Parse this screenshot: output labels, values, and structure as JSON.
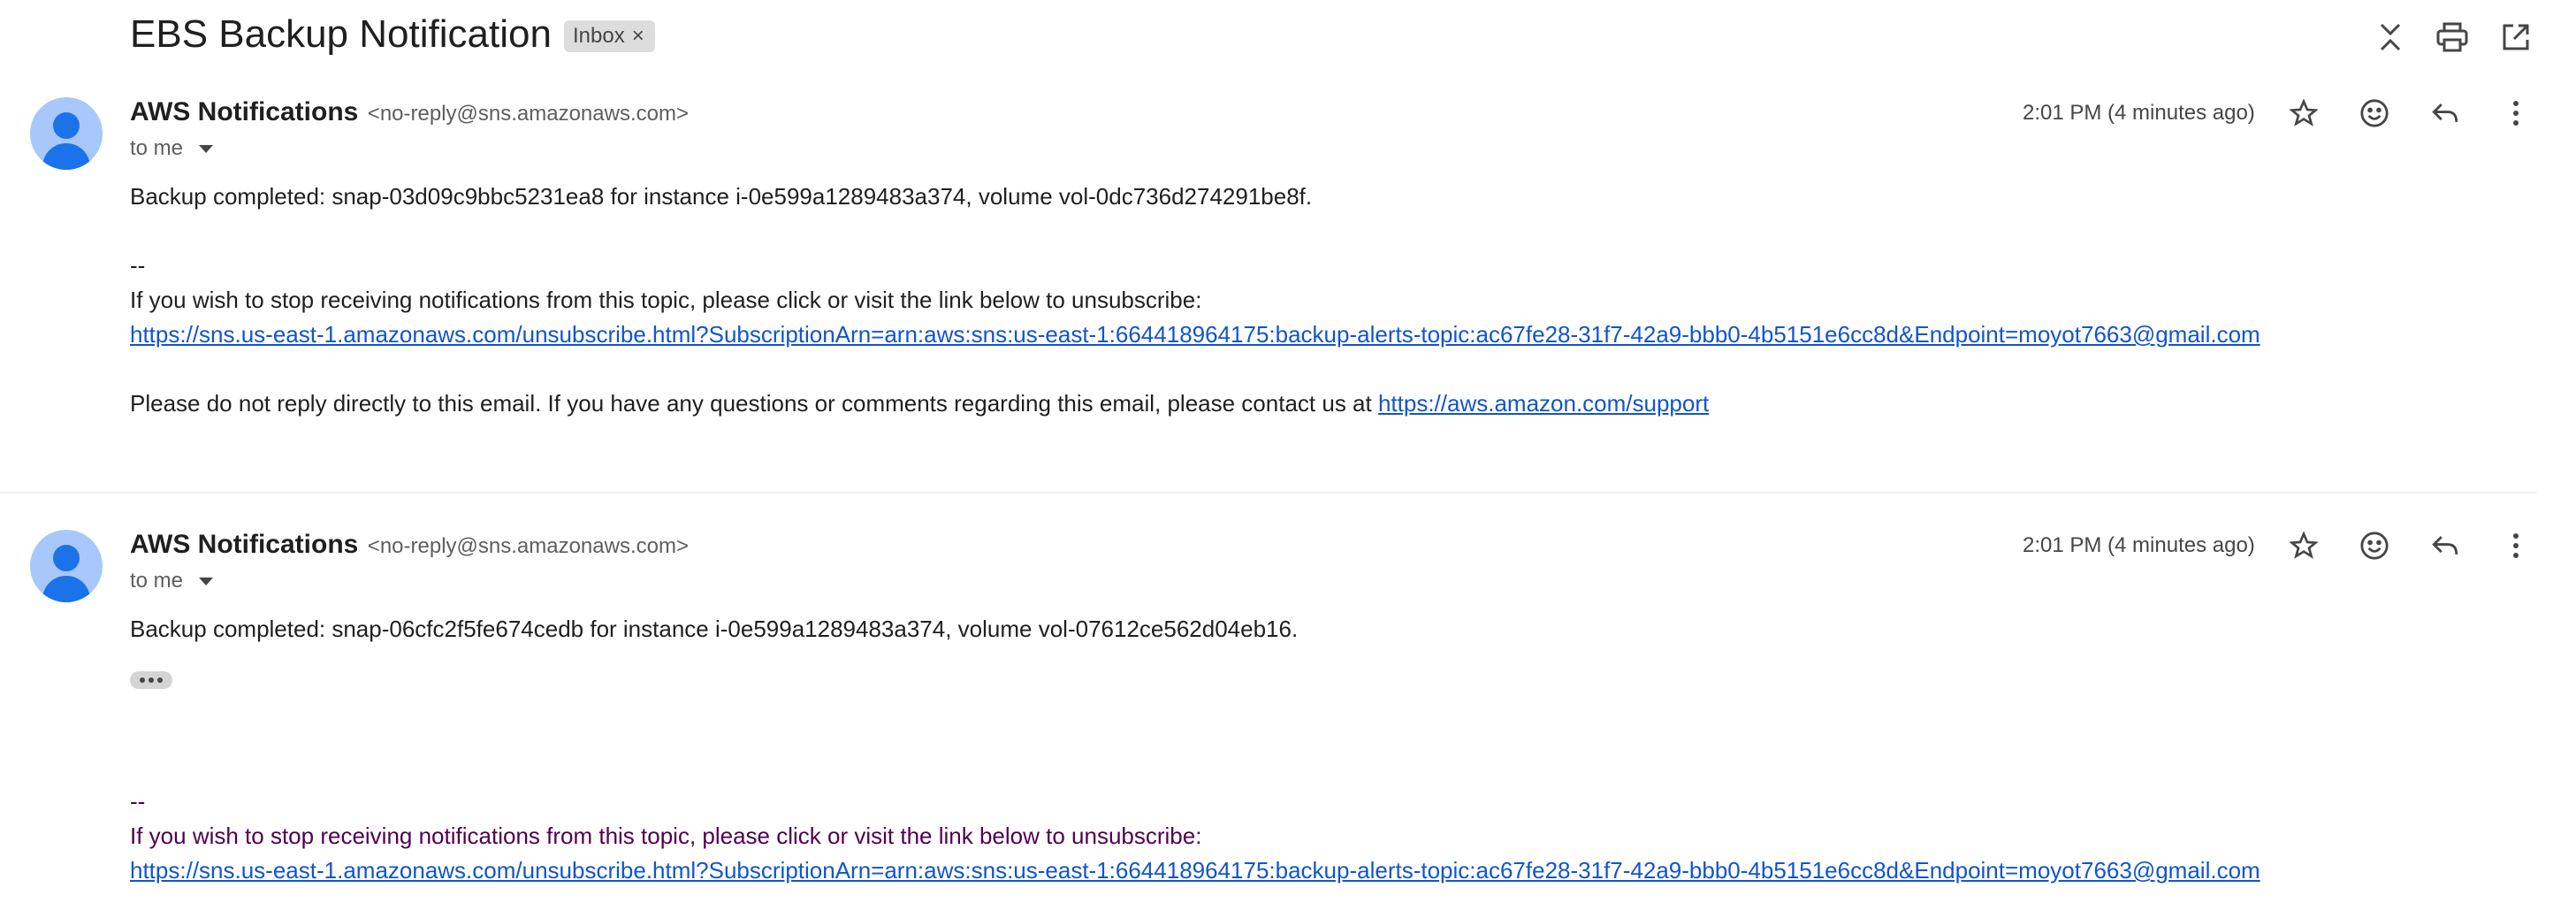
{
  "thread": {
    "subject": "EBS Backup Notification",
    "label": "Inbox",
    "label_remove": "×"
  },
  "toolbar_icons": [
    "collapse-all-icon",
    "print-icon",
    "open-in-new-window-icon"
  ],
  "messages": [
    {
      "sender_name": "AWS Notifications",
      "sender_email": "<no-reply@sns.amazonaws.com>",
      "recipient": "to me",
      "timestamp": "2:01 PM (4 minutes ago)",
      "body_line1": "Backup completed: snap-03d09c9bbc5231ea8 for instance i-0e599a1289483a374, volume vol-0dc736d274291be8f.",
      "separator": "--",
      "unsubscribe_text": "If you wish to stop receiving notifications from this topic, please click or visit the link below to unsubscribe:",
      "unsubscribe_link": "https://sns.us-east-1.amazonaws.com/unsubscribe.html?SubscriptionArn=arn:aws:sns:us-east-1:664418964175:backup-alerts-topic:ac67fe28-31f7-42a9-bbb0-4b5151e6cc8d&Endpoint=moyot7663@gmail.com",
      "noreply_text": "Please do not reply directly to this email. If you have any questions or comments regarding this email, please contact us at ",
      "support_link": "https://aws.amazon.com/support"
    },
    {
      "sender_name": "AWS Notifications",
      "sender_email": "<no-reply@sns.amazonaws.com>",
      "recipient": "to me",
      "timestamp": "2:01 PM (4 minutes ago)",
      "body_line1": "Backup completed: snap-06cfc2f5fe674cedb for instance i-0e599a1289483a374, volume vol-07612ce562d04eb16.",
      "separator": "--",
      "unsubscribe_text": "If you wish to stop receiving notifications from this topic, please click or visit the link below to unsubscribe:",
      "unsubscribe_link": "https://sns.us-east-1.amazonaws.com/unsubscribe.html?SubscriptionArn=arn:aws:sns:us-east-1:664418964175:backup-alerts-topic:ac67fe28-31f7-42a9-bbb0-4b5151e6cc8d&Endpoint=moyot7663@gmail.com"
    }
  ],
  "message_icons": [
    "star-icon",
    "emoji-reaction-icon",
    "reply-icon",
    "more-options-icon"
  ],
  "colors": {
    "link": "#1155cc",
    "quoted_text": "#500050",
    "avatar_bg": "#a8c7fa",
    "avatar_fg": "#1a73e8",
    "label_chip": "#dddddd"
  }
}
